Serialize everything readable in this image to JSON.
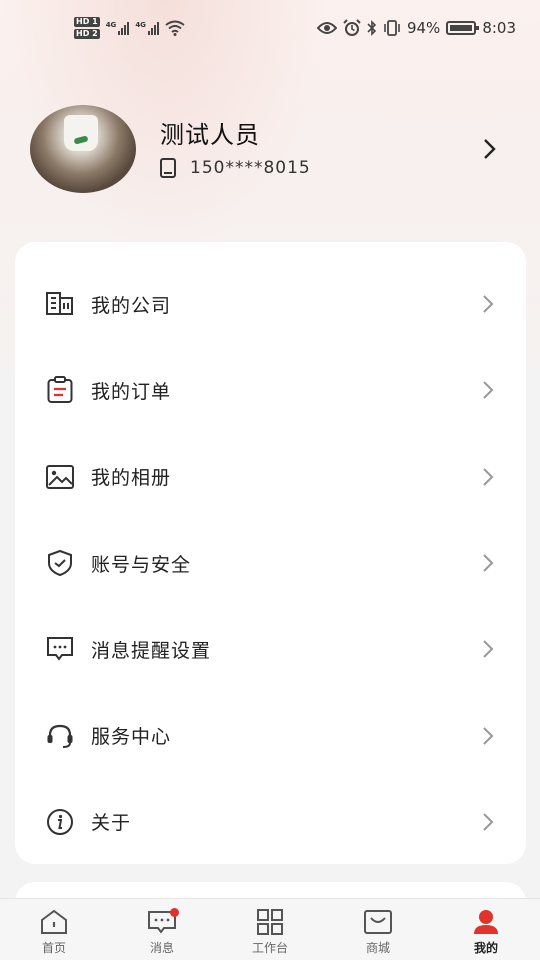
{
  "status_bar": {
    "hd1": "HD 1",
    "hd2": "HD 2",
    "net1": "4G",
    "net2": "4G",
    "battery": "94%",
    "time": "8:03"
  },
  "profile": {
    "name": "测试人员",
    "phone": "150****8015"
  },
  "menu": [
    {
      "label": "我的公司",
      "icon": "building-icon"
    },
    {
      "label": "我的订单",
      "icon": "order-clipboard-icon"
    },
    {
      "label": "我的相册",
      "icon": "image-icon"
    },
    {
      "label": "账号与安全",
      "icon": "shield-icon"
    },
    {
      "label": "消息提醒设置",
      "icon": "message-icon"
    },
    {
      "label": "服务中心",
      "icon": "headset-icon"
    },
    {
      "label": "关于",
      "icon": "info-icon"
    }
  ],
  "tabs": [
    {
      "label": "首页",
      "icon": "home-icon"
    },
    {
      "label": "消息",
      "icon": "message-icon",
      "badge": true
    },
    {
      "label": "工作台",
      "icon": "grid-icon"
    },
    {
      "label": "商城",
      "icon": "mall-icon"
    },
    {
      "label": "我的",
      "icon": "profile-icon",
      "active": true
    }
  ],
  "colors": {
    "accent": "#e0332e",
    "text": "#222222",
    "muted": "#999999"
  }
}
